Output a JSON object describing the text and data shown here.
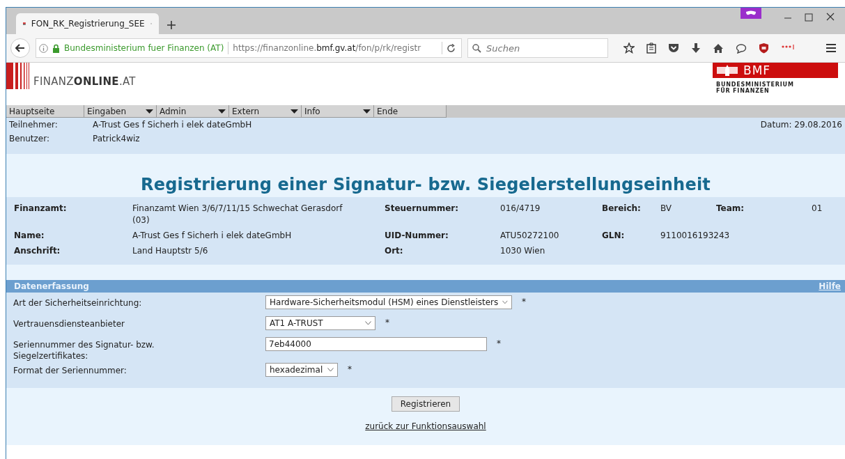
{
  "browser": {
    "tab_title": "FON_RK_Registrierung_SEE",
    "site_identity": "Bundesministerium fuer Finanzen (AT)",
    "url_start": "https://finanzonline.",
    "url_domain": "bmf.gv.at",
    "url_path": "/fon/p/rk/registr",
    "search_placeholder": "Suchen"
  },
  "header": {
    "logo": "FINANZ**ONLINE**.AT",
    "bmf_title": "BMF",
    "bmf_subtitle_lines": [
      "BUNDESMINISTERIUM",
      "FÜR FINANZEN"
    ]
  },
  "menu": [
    {
      "label": "Hauptseite",
      "dropdown": false
    },
    {
      "label": "Eingaben",
      "dropdown": true
    },
    {
      "label": "Admin",
      "dropdown": true
    },
    {
      "label": "Extern",
      "dropdown": true
    },
    {
      "label": "Info",
      "dropdown": true
    },
    {
      "label": "Ende",
      "dropdown": false
    }
  ],
  "session": {
    "participant_label": "Teilnehmer:",
    "participant": "A-Trust Ges f Sicherh i elek dateGmbH",
    "user_label": "Benutzer:",
    "user": "Patrick4wiz",
    "date": "Datum: 29.08.2016"
  },
  "title": "Registrierung einer Signatur- bzw. Siegelerstellungseinheit",
  "details": [
    [
      {
        "label": "Finanzamt:",
        "value": "Finanzamt Wien 3/6/7/11/15 Schwechat Gerasdorf (03)"
      },
      {
        "label": "Steuernummer:",
        "value": "016/4719"
      },
      {
        "label": "Bereich:",
        "value": "BV"
      },
      {
        "label": "Team:",
        "value": "01"
      }
    ],
    [
      {
        "label": "Name:",
        "value": "A-Trust Ges f Sicherh i elek dateGmbH"
      },
      {
        "label": "UID-Nummer:",
        "value": "ATU50272100"
      },
      {
        "label": "GLN:",
        "value": "9110016193243"
      }
    ],
    [
      {
        "label": "Anschrift:",
        "value": "Land Hauptstr 5/6"
      },
      {
        "label": "Ort:",
        "value": "1030 Wien"
      }
    ]
  ],
  "form": {
    "heading": "Datenerfassung",
    "help": "Hilfe",
    "fields": [
      {
        "kind": "select",
        "label": "Art der Sicherheitseinrichtung:",
        "value": "Hardware-Sicherheitsmodul (HSM) eines Dienstleisters",
        "required_mark": "*"
      },
      {
        "kind": "select",
        "label": "Vertrauensdiensteanbieter",
        "value": "AT1 A-TRUST",
        "required_mark": "*"
      },
      {
        "kind": "text",
        "label": "Seriennummer des Signatur- bzw. Siegelzertifikates:",
        "value": "7eb44000",
        "required_mark": "*"
      },
      {
        "kind": "select",
        "label": "Format der Seriennummer:",
        "value": "hexadezimal",
        "required_mark": "*"
      }
    ],
    "submit": "Registrieren",
    "back_link": "zurück zur Funktionsauswahl"
  }
}
